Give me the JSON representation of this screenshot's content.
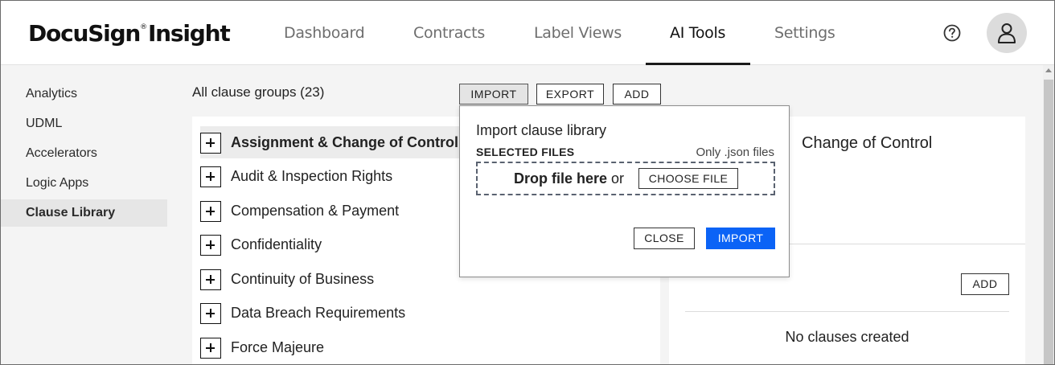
{
  "header": {
    "logo": "DocuSign",
    "logo_suffix": "Insight",
    "logo_mark": "®",
    "tabs": [
      {
        "label": "Dashboard"
      },
      {
        "label": "Contracts"
      },
      {
        "label": "Label Views"
      },
      {
        "label": "AI Tools"
      },
      {
        "label": "Settings"
      }
    ],
    "active_tab": "AI Tools",
    "icons": [
      "help-circle-icon",
      "user-avatar-icon"
    ]
  },
  "sidebar": {
    "items": [
      {
        "label": "Analytics"
      },
      {
        "label": "UDML"
      },
      {
        "label": "Accelerators"
      },
      {
        "label": "Logic Apps"
      },
      {
        "label": "Clause Library"
      }
    ],
    "active": "Clause Library"
  },
  "main": {
    "groups_title": "All clause groups (23)",
    "toolbar": {
      "import_label": "IMPORT",
      "export_label": "EXPORT",
      "add_label": "ADD"
    },
    "groups": [
      {
        "label": "Assignment & Change of Control"
      },
      {
        "label": "Audit & Inspection Rights"
      },
      {
        "label": "Compensation & Payment"
      },
      {
        "label": "Confidentiality"
      },
      {
        "label": "Continuity of Business"
      },
      {
        "label": "Data Breach Requirements"
      },
      {
        "label": "Force Majeure"
      }
    ],
    "selected_group": "Assignment & Change of Control"
  },
  "detail": {
    "title": "Change of Control",
    "add_label": "ADD",
    "empty_text": "No clauses created"
  },
  "import_dialog": {
    "title": "Import clause library",
    "selected_files_label": "SELECTED FILES",
    "hint": "Only .json files",
    "drop_text_bold": "Drop file here",
    "drop_text_or": " or",
    "choose_label": "CHOOSE FILE",
    "close_label": "CLOSE",
    "import_label": "IMPORT"
  },
  "colors": {
    "primary": "#0b63f6",
    "background": "#f4f4f4",
    "panel": "#ffffff"
  }
}
